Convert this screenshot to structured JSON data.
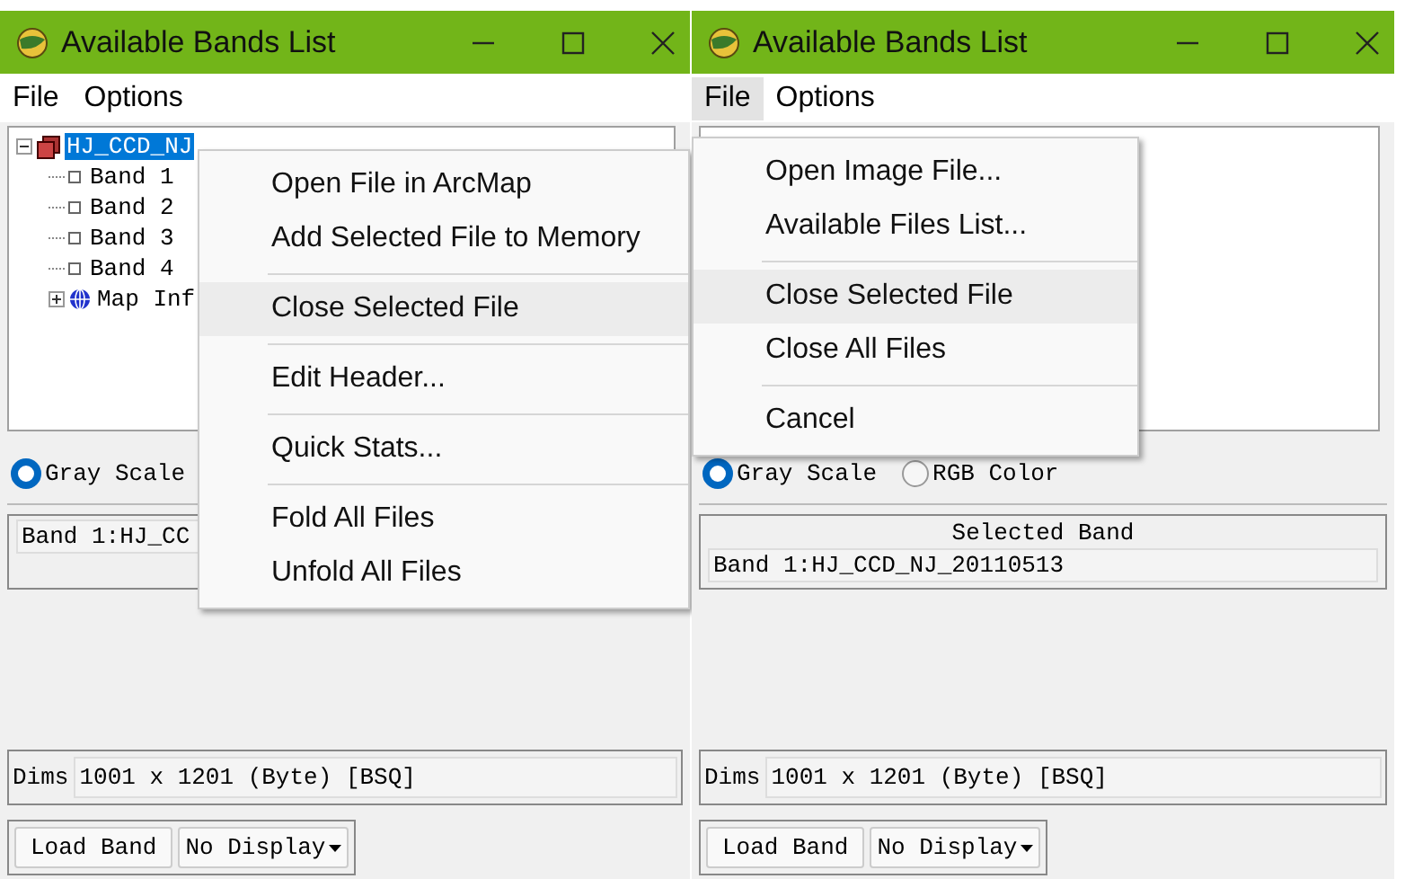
{
  "windows": [
    {
      "title": "Available Bands List",
      "menus": [
        {
          "label": "File",
          "selected": false
        },
        {
          "label": "Options",
          "selected": false
        }
      ],
      "tree": [
        {
          "label": "HJ_CCD_NJ",
          "kind": "file",
          "selected": true,
          "expanded": true,
          "children": [
            {
              "label": "Band 1",
              "kind": "band",
              "selected": false
            },
            {
              "label": "Band 2",
              "kind": "band",
              "selected": false
            },
            {
              "label": "Band 3",
              "kind": "band",
              "selected": false
            },
            {
              "label": "Band 4",
              "kind": "band",
              "selected": false
            },
            {
              "label": "Map Inf",
              "kind": "map",
              "selected": false,
              "expanded": false
            }
          ]
        }
      ],
      "radios": [
        {
          "label": "Gray Scale",
          "selected": true
        }
      ],
      "selected_band": {
        "value": "Band 1:HJ_CC"
      },
      "dims": {
        "label": "Dims",
        "value": "1001 x 1201 (Byte) [BSQ]"
      },
      "load_button": "Load Band",
      "display_select": "No Display",
      "popup": {
        "kind": "context",
        "items": [
          {
            "label": "Open File in ArcMap",
            "separator_before": false,
            "highlighted": false
          },
          {
            "label": "Add Selected File to Memory",
            "separator_before": false,
            "highlighted": false
          },
          {
            "label": "Close Selected File",
            "separator_before": true,
            "highlighted": true
          },
          {
            "label": "Edit Header...",
            "separator_before": true,
            "highlighted": false
          },
          {
            "label": "Quick Stats...",
            "separator_before": true,
            "highlighted": false
          },
          {
            "label": "Fold All Files",
            "separator_before": true,
            "highlighted": false
          },
          {
            "label": "Unfold All Files",
            "separator_before": false,
            "highlighted": false
          }
        ]
      }
    },
    {
      "title": "Available Bands List",
      "menus": [
        {
          "label": "File",
          "selected": true
        },
        {
          "label": "Options",
          "selected": false
        }
      ],
      "radios": [
        {
          "label": "Gray Scale",
          "selected": true
        },
        {
          "label": "RGB Color",
          "selected": false
        }
      ],
      "selected_band": {
        "heading": "Selected Band",
        "value": "Band 1:HJ_CCD_NJ_20110513"
      },
      "dims": {
        "label": "Dims",
        "value": "1001 x 1201 (Byte) [BSQ]"
      },
      "load_button": "Load Band",
      "display_select": "No Display",
      "popup": {
        "kind": "dropdown",
        "items": [
          {
            "label": "Open Image File...",
            "separator_before": false,
            "highlighted": false
          },
          {
            "label": "Available Files List...",
            "separator_before": false,
            "highlighted": false
          },
          {
            "label": "Close Selected File",
            "separator_before": true,
            "highlighted": true
          },
          {
            "label": "Close All Files",
            "separator_before": false,
            "highlighted": false
          },
          {
            "label": "Cancel",
            "separator_before": true,
            "highlighted": false
          }
        ]
      }
    }
  ]
}
